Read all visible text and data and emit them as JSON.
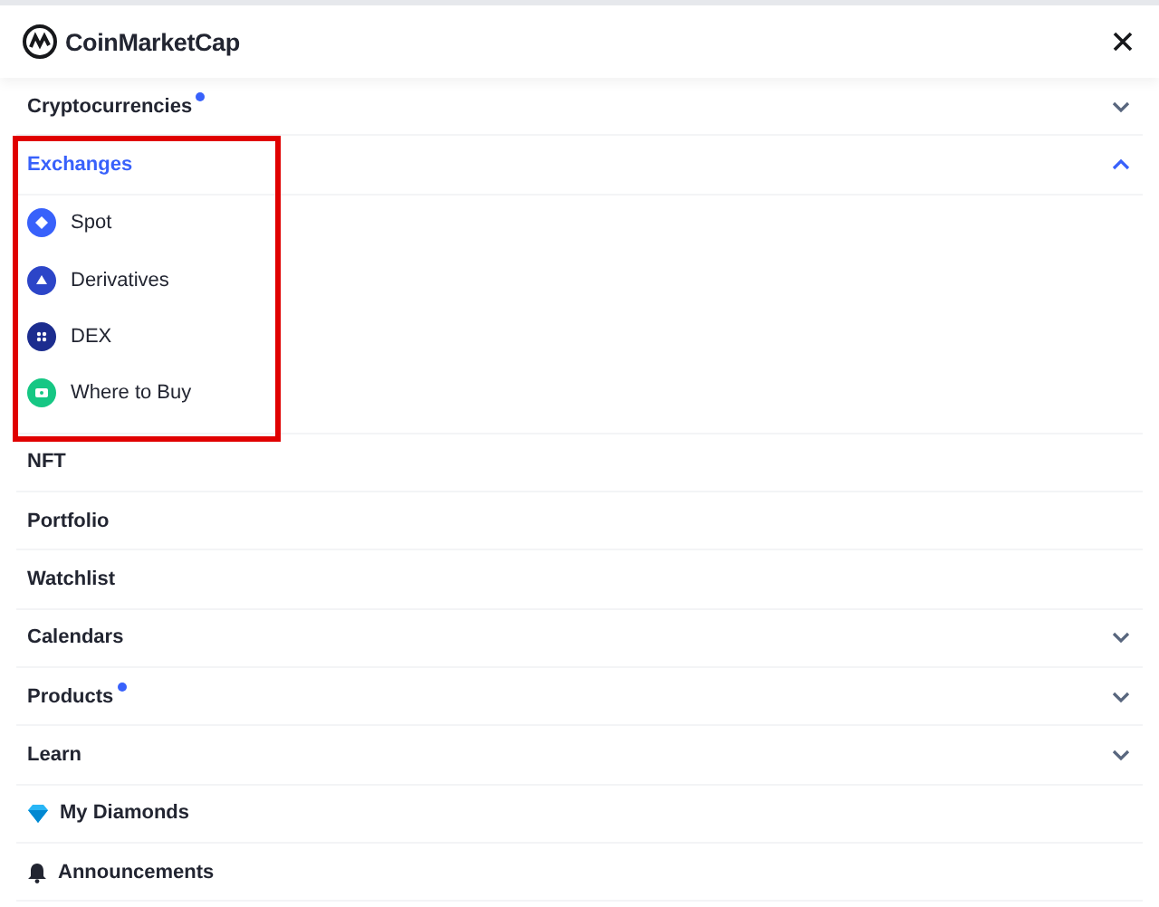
{
  "header": {
    "logo_text": "CoinMarketCap"
  },
  "menu": [
    {
      "kind": "section",
      "label": "Cryptocurrencies",
      "new_dot": true,
      "expanded": false,
      "highlighted": false
    },
    {
      "kind": "section",
      "label": "Exchanges",
      "new_dot": false,
      "expanded": true,
      "highlighted": true,
      "children": [
        {
          "label": "Spot",
          "color": "#3861fb"
        },
        {
          "label": "Derivatives",
          "color": "#2c45c8"
        },
        {
          "label": "DEX",
          "color": "#1c2d8f"
        },
        {
          "label": "Where to Buy",
          "color": "#16c784"
        }
      ]
    },
    {
      "kind": "link",
      "label": "NFT"
    },
    {
      "kind": "link",
      "label": "Portfolio"
    },
    {
      "kind": "link",
      "label": "Watchlist"
    },
    {
      "kind": "section",
      "label": "Calendars",
      "new_dot": false,
      "expanded": false,
      "highlighted": false
    },
    {
      "kind": "section",
      "label": "Products",
      "new_dot": true,
      "expanded": false,
      "highlighted": false
    },
    {
      "kind": "section",
      "label": "Learn",
      "new_dot": false,
      "expanded": false,
      "highlighted": false
    },
    {
      "kind": "icon-link",
      "label": "My Diamonds"
    },
    {
      "kind": "icon-link",
      "label": "Announcements"
    }
  ]
}
